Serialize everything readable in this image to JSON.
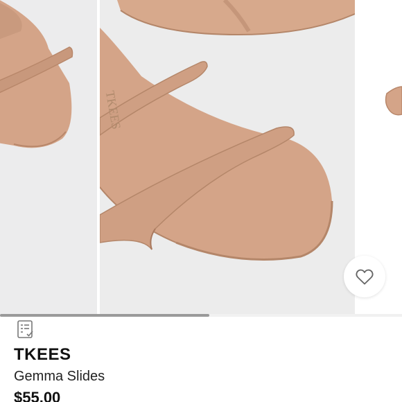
{
  "listing": {
    "brand": "TKEES",
    "product_name": "Gemma Slides",
    "price": "$55.00",
    "image_stamp": "TKEES"
  },
  "carousel": {
    "image_count": 3,
    "scroll_progress": 0.52
  },
  "icons": {
    "like": "heart-outline-icon",
    "listing": "listing-details-icon"
  },
  "colors": {
    "sandal_leather": "#d4a488",
    "sandal_shadow": "#b8876a",
    "background": "#ececec",
    "scroll_thumb": "#9a9a9a"
  }
}
